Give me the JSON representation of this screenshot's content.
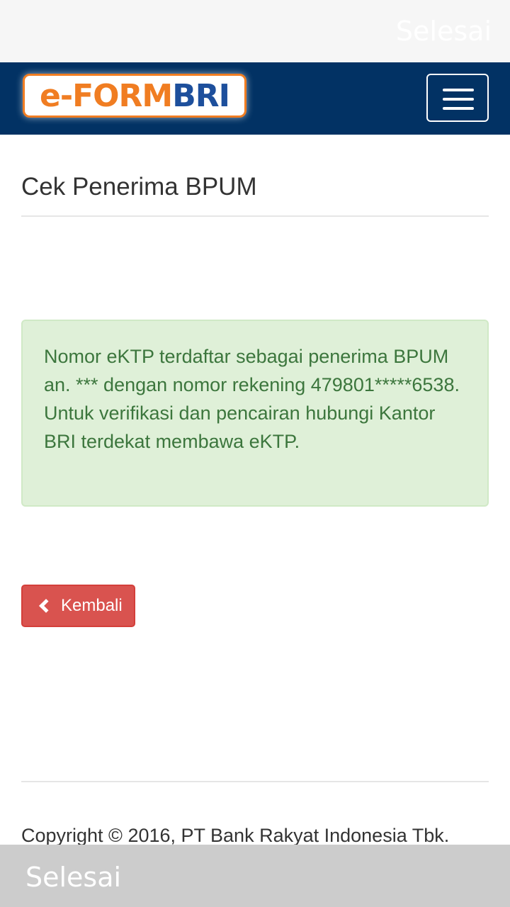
{
  "top_bar": {
    "done_label": "Selesai"
  },
  "navbar": {
    "logo": {
      "part1": "e-FORM",
      "part2": "BRI"
    },
    "menu_icon": "hamburger-icon"
  },
  "page": {
    "title": "Cek Penerima BPUM"
  },
  "alert": {
    "message": "Nomor eKTP terdaftar sebagai penerima BPUM an. *** dengan nomor rekening 479801*****6538. Untuk verifikasi dan pencairan hubungi Kantor BRI terdekat membawa eKTP."
  },
  "back_button": {
    "label": "Kembali",
    "icon": "chevron-left-icon"
  },
  "footer": {
    "copyright": "Copyright © 2016, PT Bank Rakyat Indonesia Tbk."
  },
  "bottom_bar": {
    "done_label": "Selesai"
  },
  "colors": {
    "navbar": "#023264",
    "alert_bg": "#dff0d8",
    "alert_text": "#3c763d",
    "danger": "#d9534f",
    "logo_orange": "#f07d22",
    "logo_blue": "#1d4f9c"
  }
}
